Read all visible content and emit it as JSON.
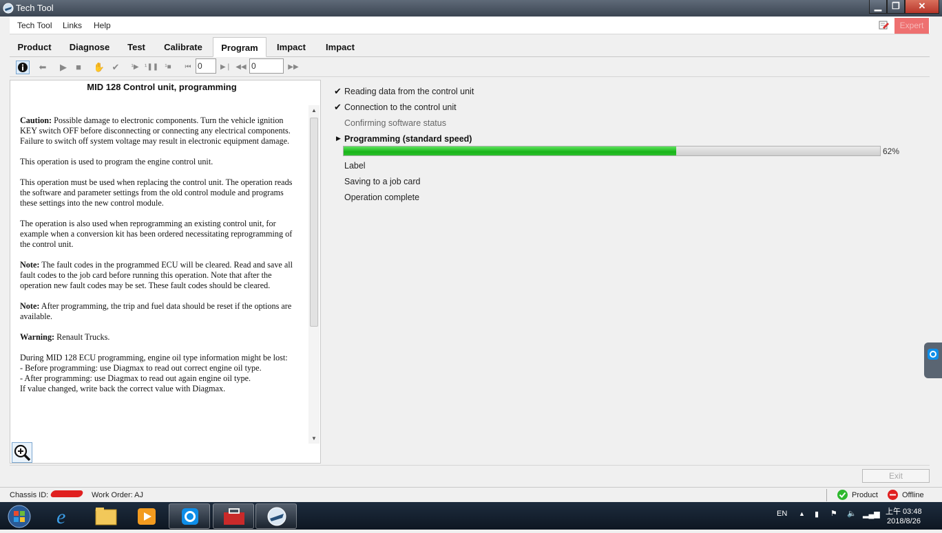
{
  "window": {
    "title": "Tech Tool",
    "minimize": "▁",
    "maximize": "❐",
    "close": "✕"
  },
  "menu": {
    "items": [
      "Tech Tool",
      "Links",
      "Help"
    ],
    "expert": "Expert"
  },
  "tabs": [
    {
      "label": "Product",
      "active": false
    },
    {
      "label": "Diagnose",
      "active": false
    },
    {
      "label": "Test",
      "active": false
    },
    {
      "label": "Calibrate",
      "active": false
    },
    {
      "label": "Program",
      "active": true
    },
    {
      "label": "Impact",
      "active": false
    },
    {
      "label": "Impact",
      "active": false
    }
  ],
  "toolbar": {
    "field1": "0",
    "field2": "0"
  },
  "doc": {
    "title": "MID 128 Control unit, programming",
    "caution_label": "Caution:",
    "caution_text": " Possible damage to electronic components. Turn the vehicle ignition KEY switch OFF before disconnecting or connecting any electrical components. Failure to switch off system voltage may result in electronic equipment damage.",
    "p1": "This operation is used to program the engine control unit.",
    "p2": "This operation must be used when replacing the control unit. The operation reads the software and parameter settings from the old control module and programs these settings into the new control module.",
    "p3": "The operation is also used when reprogramming an existing control unit, for example when a conversion kit has been ordered necessitating reprogramming of the control unit.",
    "note1_label": "Note:",
    "note1_text": " The fault codes in the programmed ECU will be cleared. Read and save all fault codes to the job card before running this operation. Note that after the operation new fault codes may be set. These fault codes should be cleared.",
    "note2_label": "Note:",
    "note2_text": " After programming, the trip and fuel data should be reset if the options are available.",
    "warning_label": "Warning:",
    "warning_text": " Renault Trucks.",
    "p4_line1": "During MID 128 ECU programming, engine oil type information might be lost:",
    "p4_line2": "- Before programming: use Diagmax to read out correct engine oil type.",
    "p4_line3": "- After programming: use Diagmax to read out again engine oil type.",
    "p4_line4": "If value changed, write back the correct value with Diagmax."
  },
  "steps": [
    {
      "label": "Reading data from the control unit",
      "state": "done"
    },
    {
      "label": "Connection to the control unit",
      "state": "done"
    },
    {
      "label": "Confirming software status",
      "state": "skipped"
    },
    {
      "label": "Programming  (standard speed)",
      "state": "active"
    },
    {
      "label": "Label",
      "state": "pending"
    },
    {
      "label": "Saving to a job card",
      "state": "pending"
    },
    {
      "label": "Operation complete",
      "state": "pending"
    }
  ],
  "progress": {
    "value": 0.62,
    "label": "62%"
  },
  "bottom": {
    "exit": "Exit"
  },
  "status": {
    "chassis_label": "Chassis ID:",
    "work_order": "Work Order: AJ",
    "product": "Product",
    "offline": "Offline"
  },
  "tray": {
    "lang": "EN",
    "time": "上午 03:48",
    "date": "2018/8/26"
  },
  "colors": {
    "accent": "#18b418",
    "expert": "#ee7070",
    "offline": "#e02020",
    "product_ok": "#2eb82e"
  }
}
